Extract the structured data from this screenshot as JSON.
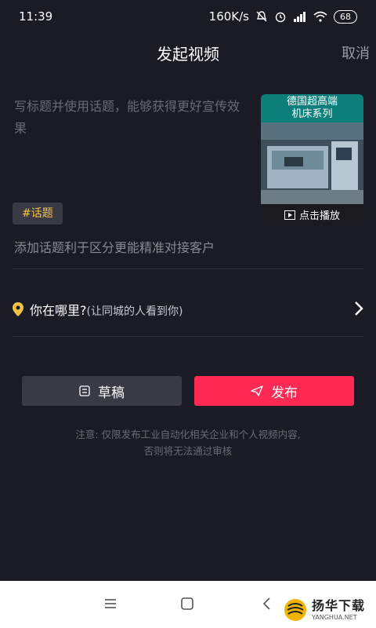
{
  "status_bar": {
    "time": "11:39",
    "net_speed": "160K/s",
    "battery": "68",
    "icons": [
      "mute-icon",
      "alarm-icon",
      "signal-icon",
      "wifi-icon",
      "battery-icon"
    ]
  },
  "header": {
    "title": "发起视频",
    "cancel_label": "取消"
  },
  "editor": {
    "placeholder": "写标题并使用话题，能够获得更好宣传效果",
    "tag_chip": "#话题",
    "topic_hint": "添加话题利于区分更能精准对接客户"
  },
  "thumbnail": {
    "caption_line1": "德国超高端",
    "caption_line2": "机床系列",
    "play_label": "点击播放"
  },
  "location": {
    "label": "你在哪里?",
    "sublabel": "(让同城的人看到你)",
    "accent_color": "#f5c343"
  },
  "actions": {
    "draft_label": "草稿",
    "publish_label": "发布",
    "publish_color": "#ff2a54"
  },
  "notice": {
    "line1": "注意: 仅限发布工业自动化相关企业和个人视频内容,",
    "line2": "否则将无法通过审核"
  },
  "watermark": {
    "name": "扬华下载",
    "url": "YANGHUA.NET"
  }
}
